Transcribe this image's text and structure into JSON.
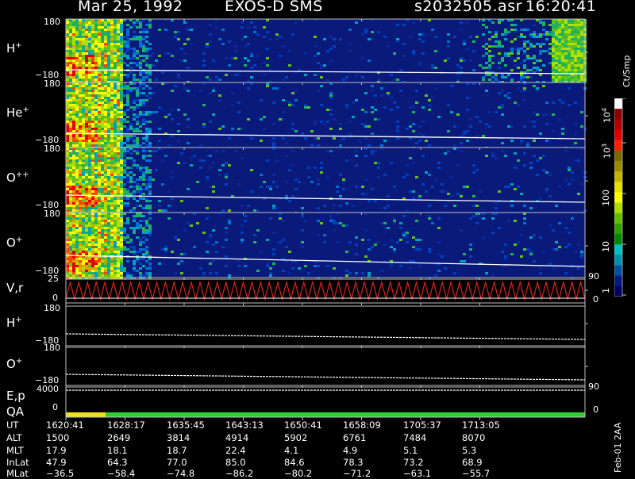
{
  "header": {
    "date": "Mar 25, 1992",
    "instrument": "EXOS-D SMS",
    "file": "s2032505.asr",
    "time": "16:20:41"
  },
  "panels": {
    "hplus": {
      "label": "H",
      "sup": "+",
      "top": "180",
      "bottom": "−180"
    },
    "heplus": {
      "label": "He",
      "sup": "+",
      "top": "180",
      "bottom": "−180"
    },
    "oplusplus": {
      "label": "O",
      "sup": "++",
      "top": "180",
      "bottom": "−180"
    },
    "oplus": {
      "label": "O",
      "sup": "+",
      "top": "180",
      "bottom": "−180"
    },
    "vr": {
      "label": "V,r",
      "top": "25",
      "bottom": "0",
      "right_top": "90",
      "right_bottom": "0"
    },
    "hplus2": {
      "label": "H",
      "sup": "+",
      "top": "180",
      "bottom": "−180"
    },
    "oplus2": {
      "label": "O",
      "sup": "+",
      "top": "180",
      "bottom": "−180"
    },
    "ep": {
      "label": "E,p",
      "top": "4000",
      "right": "90"
    },
    "qa": {
      "label": "QA",
      "bottom": "0",
      "right": "0"
    }
  },
  "colorbar": {
    "unit": "Ct/Smp",
    "ticks": [
      "10^4",
      "10^3",
      "100",
      "10",
      "1"
    ],
    "colors": [
      "#ffffff",
      "#8b0000",
      "#b00000",
      "#e00000",
      "#ff2000",
      "#7a6a00",
      "#9a8a00",
      "#c8b400",
      "#e8e000",
      "#ffff00",
      "#b0e000",
      "#60c000",
      "#30a000",
      "#008800",
      "#00c0c0",
      "#0090b0",
      "#0050a0",
      "#001a80",
      "#000060"
    ]
  },
  "colors": {
    "background": "#000000",
    "spectrogram_bg": "#0a1a7a",
    "qa_yellow": "#f0e020",
    "qa_green": "#30d030",
    "vr_red": "#e02020"
  },
  "footer_note": "Feb-01 2AA",
  "orbit_table": {
    "row_labels": [
      "UT",
      "ALT",
      "MLT",
      "InLat",
      "MLat"
    ],
    "columns": [
      [
        "1620:41",
        "1500",
        "17.9",
        "47.9",
        "−36.5"
      ],
      [
        "1628:17",
        "2649",
        "18.1",
        "64.3",
        "−58.4"
      ],
      [
        "1635:45",
        "3814",
        "18.7",
        "77.0",
        "−74.8"
      ],
      [
        "1643:13",
        "4914",
        "22.4",
        "85.0",
        "−86.2"
      ],
      [
        "1650:41",
        "5902",
        "4.1",
        "84.6",
        "−80.2"
      ],
      [
        "1658:09",
        "6761",
        "4.9",
        "78.3",
        "−71.2"
      ],
      [
        "1705:37",
        "7484",
        "5.1",
        "73.2",
        "−63.1"
      ],
      [
        "1713:05",
        "8070",
        "5.3",
        "68.9",
        "−55.7"
      ]
    ]
  },
  "chart_data": {
    "type": "heatmap",
    "time_ticks": [
      "1620:41",
      "1628:17",
      "1635:45",
      "1643:13",
      "1650:41",
      "1658:09",
      "1705:37",
      "1713:05"
    ],
    "panels": [
      "H+",
      "He+",
      "O++",
      "O+",
      "V,r",
      "H+",
      "O+",
      "E,p",
      "QA"
    ],
    "pitch_angle_range": [
      -180,
      180
    ],
    "colorbar_range": [
      1,
      10000
    ],
    "colorbar_scale": "log",
    "qa_segments": [
      {
        "from_fraction": 0.0,
        "to_fraction": 0.077,
        "color": "#f0e020"
      },
      {
        "from_fraction": 0.077,
        "to_fraction": 1.0,
        "color": "#30d030"
      }
    ]
  }
}
